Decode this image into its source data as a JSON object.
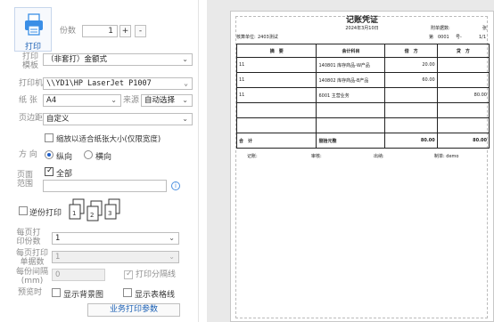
{
  "print": {
    "label": "打印"
  },
  "copies": {
    "label": "份数",
    "value": "1",
    "plus": "+",
    "minus": "-"
  },
  "print_template": {
    "label": "打印模板",
    "value": "（非套打）金额式"
  },
  "printer": {
    "label": "打印机",
    "value": "\\\\YD1\\HP LaserJet P1007"
  },
  "paper": {
    "label": "纸 张",
    "value": "A4",
    "source_label": "来源",
    "source_value": "自动选择"
  },
  "margin": {
    "label": "页边距",
    "value": "自定义"
  },
  "shrink": {
    "label": "缩放以适合纸张大小(仅限宽度)",
    "checked": false
  },
  "orientation": {
    "label": "方 向",
    "portrait": "纵向",
    "landscape": "横向",
    "selected": "portrait"
  },
  "page_range": {
    "label": "页面范围",
    "all_label": "全部",
    "all_checked": true,
    "input": ""
  },
  "reverse_print": {
    "label": "逆份打印",
    "checked": false
  },
  "per_page_copies": {
    "label": "每页打印份数",
    "value": "1"
  },
  "per_page_docs": {
    "label": "每页打印单据数",
    "value": "1"
  },
  "copy_gap": {
    "label": "每份间隔(mm)",
    "value": "0",
    "separator_label": "打印分隔线",
    "separator_checked": true
  },
  "preview": {
    "label": "预览时",
    "show_bg": "显示背景图",
    "show_grid": "显示表格线"
  },
  "business_params": {
    "label": "业务打印参数"
  },
  "doc": {
    "title": "记账凭证",
    "date": "2024年3月10日",
    "attachments_label": "附单据数:",
    "attachments_value": "张",
    "unit_label": "核算单位:",
    "unit_value": "2403测试",
    "voucher_label": "第",
    "voucher_no": "0001",
    "voucher_suffix": "号-",
    "page": "1/1",
    "headers": [
      "摘　要",
      "会计科目",
      "借　方",
      "贷　方"
    ],
    "rows": [
      [
        "11",
        "140801 库存商品-W产品",
        "20.00",
        ""
      ],
      [
        "11",
        "140802 库存商品-B产品",
        "60.00",
        ""
      ],
      [
        "11",
        "6001 主营业务",
        "",
        "80.00"
      ],
      [
        "",
        "",
        "",
        ""
      ],
      [
        "",
        "",
        "",
        ""
      ]
    ],
    "total_label": "合　计",
    "total_text": "捌拾元整",
    "total_debit": "80.00",
    "total_credit": "80.00",
    "footer": [
      "记账:",
      "审核:",
      "出纳:",
      "制单: demo"
    ]
  }
}
